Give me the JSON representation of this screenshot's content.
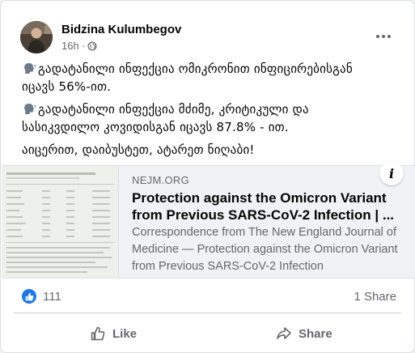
{
  "post": {
    "author": "Bidzina Kulumbegov",
    "time": "16h",
    "dot": "·",
    "privacy_icon": "globe-icon",
    "more_icon": "more-horizontal-icon",
    "lines": [
      "გადატანილი ინფექცია ომიკრონით ინფიცირებისგან",
      "იცავს 56%-ით.",
      "გადატანილი ინფექცია მძიმე, კრიტიკული და",
      "სასიკვდილო კოვიდისგან იცავს 87.8% - ით.",
      "აიცერით, დაიბუსტეთ, ატარეთ ნიღაბი!"
    ],
    "bullet_icon": "speaking-head-icon"
  },
  "link": {
    "domain": "NEJM.ORG",
    "title": "Protection against the Omicron Variant from Previous SARS-CoV-2 Infection | ...",
    "description": "Correspondence from The New England Journal of Medicine — Protection against the Omicron Variant from Previous SARS-CoV-2 Infection",
    "info_icon": "info-icon",
    "info_glyph": "i"
  },
  "stats": {
    "reaction_icon": "like-reaction-icon",
    "reaction_count": "111",
    "shares": "1 Share"
  },
  "actions": {
    "like_label": "Like",
    "share_label": "Share"
  },
  "colors": {
    "accent": "#1877f2",
    "secondary_text": "#65676b",
    "primary_text": "#050505",
    "preview_bg": "#f0f2f5"
  }
}
